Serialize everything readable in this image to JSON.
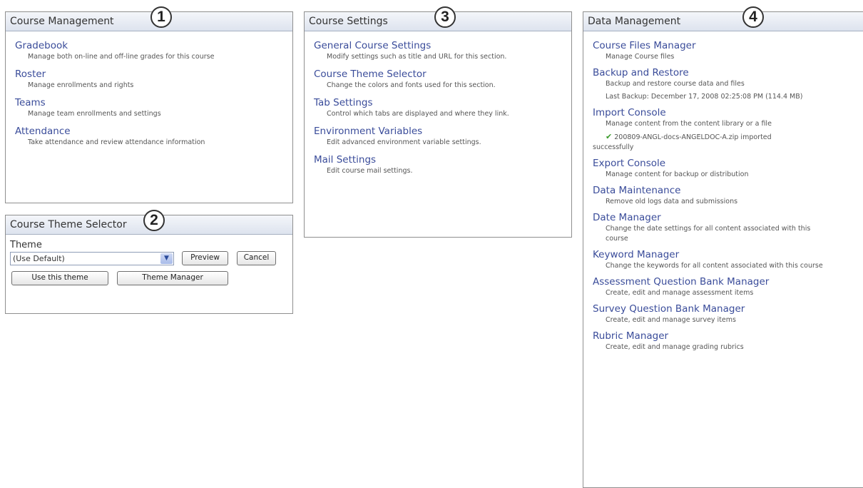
{
  "course_management": {
    "title": "Course Management",
    "badge": "1",
    "items": [
      {
        "label": "Gradebook",
        "desc": "Manage both on-line and off-line grades for this course"
      },
      {
        "label": "Roster",
        "desc": "Manage enrollments and rights"
      },
      {
        "label": "Teams",
        "desc": "Manage team enrollments and settings"
      },
      {
        "label": "Attendance",
        "desc": "Take attendance and review attendance information"
      }
    ]
  },
  "course_theme_selector": {
    "title": "Course Theme Selector",
    "badge": "2",
    "theme_label": "Theme",
    "theme_value": "(Use Default)",
    "preview_label": "Preview",
    "cancel_label": "Cancel",
    "use_label": "Use this theme",
    "manager_label": "Theme Manager"
  },
  "course_settings": {
    "title": "Course Settings",
    "badge": "3",
    "items": [
      {
        "label": "General Course Settings",
        "desc": "Modify settings such as title and URL for this section."
      },
      {
        "label": "Course Theme Selector",
        "desc": "Change the colors and fonts used for this section."
      },
      {
        "label": "Tab Settings",
        "desc": "Control which tabs are displayed and where they link."
      },
      {
        "label": "Environment Variables",
        "desc": "Edit advanced environment variable settings."
      },
      {
        "label": "Mail Settings",
        "desc": "Edit course mail settings."
      }
    ]
  },
  "data_management": {
    "title": "Data Management",
    "badge": "4",
    "items": [
      {
        "label": "Course Files Manager",
        "desc": "Manage Course files"
      },
      {
        "label": "Backup and Restore",
        "desc": "Backup and restore course data and files",
        "note": "Last Backup: December 17, 2008 02:25:08 PM (114.4 MB)"
      },
      {
        "label": "Import Console",
        "desc": "Manage content from the content library or a file",
        "status": "200809-ANGL-docs-ANGELDOC-A.zip imported successfully"
      },
      {
        "label": "Export Console",
        "desc": "Manage content for backup or distribution"
      },
      {
        "label": "Data Maintenance",
        "desc": "Remove old logs data and submissions"
      },
      {
        "label": "Date Manager",
        "desc": "Change the date settings for all content associated with this course"
      },
      {
        "label": "Keyword Manager",
        "desc": "Change the keywords for all content associated with this course"
      },
      {
        "label": "Assessment Question Bank Manager",
        "desc": "Create, edit and manage assessment items"
      },
      {
        "label": "Survey Question Bank Manager",
        "desc": "Create, edit and manage survey items"
      },
      {
        "label": "Rubric Manager",
        "desc": "Create, edit and manage grading rubrics"
      }
    ]
  }
}
